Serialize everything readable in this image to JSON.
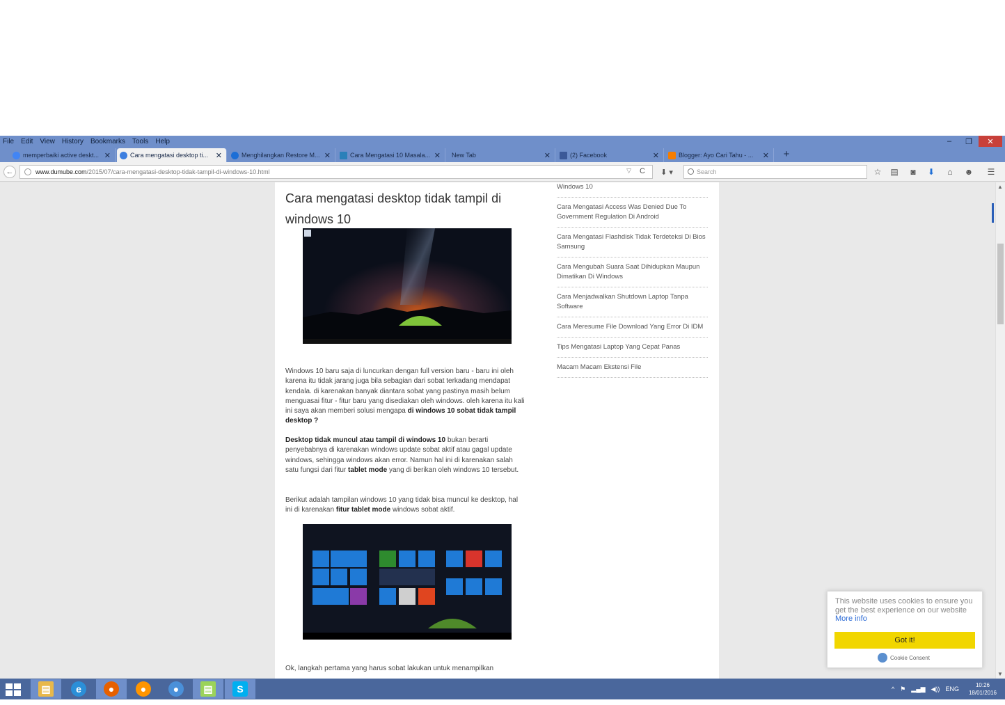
{
  "menu": [
    "File",
    "Edit",
    "View",
    "History",
    "Bookmarks",
    "Tools",
    "Help"
  ],
  "window_controls": {
    "minimize": "–",
    "restore": "❐",
    "close": "✕"
  },
  "tabs": [
    {
      "label": "memperbaiki active deskt...",
      "icon_color": "#4285f4",
      "active": false
    },
    {
      "label": "Cara mengatasi desktop ti...",
      "icon_color": "#3d7fe0",
      "active": true
    },
    {
      "label": "Menghilangkan Restore M...",
      "icon_color": "#1c6ed6",
      "active": false
    },
    {
      "label": "Cara Mengatasi 10 Masala...",
      "icon_color": "#2a80b9",
      "active": false
    },
    {
      "label": "New Tab",
      "icon_color": "transparent",
      "active": false
    },
    {
      "label": "(2) Facebook",
      "icon_color": "#3b5998",
      "active": false
    },
    {
      "label": "Blogger: Ayo Cari Tahu - ...",
      "icon_color": "#f57d00",
      "active": false
    }
  ],
  "tab_close": "✕",
  "new_tab": "+",
  "nav": {
    "back": "←",
    "url_host": "www.dumube.com",
    "url_path": "/2015/07/cara-mengatasi-desktop-tidak-tampil-di-windows-10.html",
    "dropdown": "▽",
    "reload": "C",
    "download": "⬇ ▾",
    "search_placeholder": "Search"
  },
  "toolbar_icons": {
    "star": "☆",
    "reading_list": "▤",
    "pocket": "◙",
    "download": "⬇",
    "home": "⌂",
    "chat": "☻",
    "menu": "☰"
  },
  "article": {
    "title": "Cara mengatasi desktop tidak tampil di windows 10",
    "para1_a": "Windows 10 baru saja di luncurkan dengan full version baru - baru ini oleh karena itu tidak jarang juga bila sebagian dari sobat terkadang mendapat kendala. di karenakan banyak diantara sobat yang pastinya masih belum menguasai fitur - fitur baru yang disediakan oleh windows. oleh karena itu kali ini saya akan memberi solusi mengapa ",
    "para1_b": "di windows 10 sobat tidak tampil desktop ?",
    "para2_a": "Desktop tidak muncul atau tampil di windows 10",
    "para2_b": " bukan berarti penyebabnya di karenakan windows update sobat aktif atau gagal update windows, sehingga windows akan error. Namun hal ini di karenakan salah satu fungsi dari fitur ",
    "para2_c": "tablet mode",
    "para2_d": " yang di berikan oleh windows 10 tersebut.",
    "para3_a": "Berikut adalah tampilan windows 10 yang tidak bisa muncul ke desktop, hal ini di karenakan ",
    "para3_b": "fitur tablet mode",
    "para3_c": " windows sobat aktif.",
    "para4": "Ok, langkah pertama yang harus sobat lakukan untuk menampilkan"
  },
  "sidebar": [
    "Windows 10",
    "Cara Mengatasi Access Was Denied Due To Government Regulation Di Android",
    "Cara Mengatasi Flashdisk Tidak Terdeteksi Di Bios Samsung",
    "Cara Mengubah Suara Saat Dihidupkan Maupun Dimatikan Di Windows",
    "Cara Menjadwalkan Shutdown Laptop Tanpa Software",
    "Cara Meresume File Download Yang Error Di IDM",
    "Tips Mengatasi Laptop Yang Cepat Panas",
    "Macam Macam Ekstensi File"
  ],
  "scroll": {
    "up": "▲",
    "down": "▼"
  },
  "cookie": {
    "text": "This website uses cookies to ensure you get the best experience on our website ",
    "more_info": "More info",
    "button": "Got it!",
    "brand": "Cookie Consent"
  },
  "taskbar": {
    "apps": [
      {
        "name": "file-explorer",
        "glyph": "▤",
        "color": "#e8b84a",
        "active": true
      },
      {
        "name": "internet-explorer",
        "glyph": "e",
        "color": "#2b8fd8",
        "active": false
      },
      {
        "name": "firefox",
        "glyph": "●",
        "color": "#e66000",
        "active": true
      },
      {
        "name": "orange-app",
        "glyph": "●",
        "color": "#ff9500",
        "active": false
      },
      {
        "name": "chrome",
        "glyph": "●",
        "color": "#4a90d9",
        "active": false
      },
      {
        "name": "folder-app",
        "glyph": "▤",
        "color": "#9bd35a",
        "active": true
      },
      {
        "name": "skype",
        "glyph": "S",
        "color": "#00aff0",
        "active": true
      }
    ],
    "tray_up": "^",
    "tray_flag": "⚑",
    "tray_signal": "▂▄▆",
    "tray_volume": "◀))",
    "lang": "ENG",
    "time": "10:26",
    "date": "18/01/2016"
  }
}
